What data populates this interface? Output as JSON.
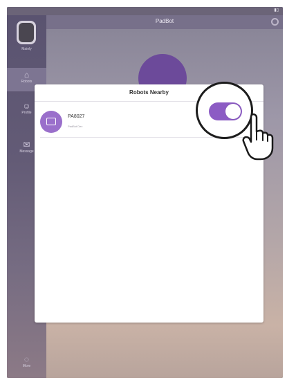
{
  "navbar": {
    "title": "PadBot"
  },
  "sidebar": {
    "items": [
      {
        "label": "Mainly",
        "icon": "avatar"
      },
      {
        "label": "Robots",
        "icon": "robot-icon"
      },
      {
        "label": "Profile",
        "icon": "person-icon"
      },
      {
        "label": "Message",
        "icon": "mail-icon"
      },
      {
        "label": "More",
        "icon": "more-icon"
      }
    ]
  },
  "modal": {
    "title": "Robots Nearby",
    "robots": [
      {
        "name": "PA8027",
        "subtitle": "PadBot Dev",
        "toggle_on": true
      }
    ]
  },
  "colors": {
    "accent": "#8c5cc4",
    "icon_bg": "#9a6fcb"
  }
}
